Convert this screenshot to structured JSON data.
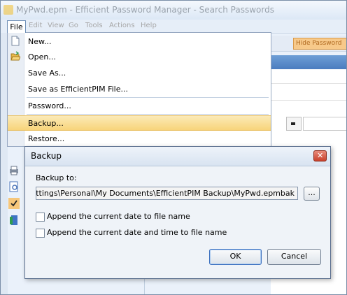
{
  "window": {
    "title": "MyPwd.epm - Efficient Password Manager - Search Passwords"
  },
  "menubar": {
    "items": [
      "File",
      "Edit",
      "View",
      "Go",
      "Tools",
      "Actions",
      "Help"
    ]
  },
  "background": {
    "hide_button_label": "Hide Password"
  },
  "file_menu": {
    "items": [
      {
        "label": "New...",
        "icon": "new-document-icon",
        "highlighted": false
      },
      {
        "label": "Open...",
        "icon": "open-folder-icon",
        "highlighted": false
      },
      {
        "label": "Save As...",
        "icon": "",
        "highlighted": false
      },
      {
        "label": "Save as EfficientPIM File...",
        "icon": "",
        "highlighted": false
      },
      {
        "label": "Password...",
        "icon": "",
        "highlighted": false
      },
      {
        "label": "Backup...",
        "icon": "",
        "highlighted": true
      },
      {
        "label": "Restore...",
        "icon": "",
        "highlighted": false
      }
    ]
  },
  "backup_dialog": {
    "title": "Backup",
    "close_label": "✕",
    "backup_to_label": "Backup to:",
    "path_value": "C:\\Documents and Settings\\Personal\\My Documents\\EfficientPIM Backup\\MyPwd.epmbak",
    "browse_label": "...",
    "append_date_label": "Append the current date to file name",
    "append_date_checked": false,
    "append_datetime_label": "Append the current date and time to file name",
    "append_datetime_checked": false,
    "ok_label": "OK",
    "cancel_label": "Cancel"
  },
  "colors": {
    "menu_highlight": "#f8d47a",
    "dialog_bg": "#eff3f8",
    "close_button": "#c8412c"
  }
}
